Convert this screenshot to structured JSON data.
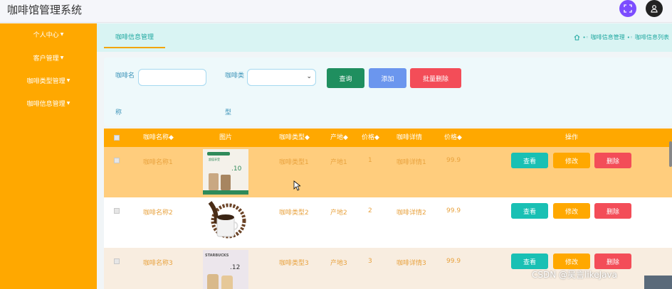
{
  "header": {
    "title": "咖啡馆管理系统",
    "expand_icon": "fullscreen-icon",
    "user_icon": "user-icon"
  },
  "sidebar": {
    "items": [
      {
        "label": "个人中心"
      },
      {
        "label": "客户管理"
      },
      {
        "label": "咖啡类型管理"
      },
      {
        "label": "咖啡信息管理"
      }
    ]
  },
  "tabs": {
    "active": "咖啡信息管理"
  },
  "breadcrumb": {
    "home_icon": "home-icon",
    "items": [
      "咖啡信息管理",
      "咖啡信息列表"
    ]
  },
  "search": {
    "name_label_1": "咖啡名",
    "name_label_2": "称",
    "name_value": "",
    "type_label_1": "咖啡类",
    "type_label_2": "型",
    "type_value": "",
    "query_label": "查询",
    "add_label": "添加",
    "batch_delete_label": "批量删除"
  },
  "table": {
    "headers": [
      "咖啡名称◆",
      "图片",
      "咖啡类型◆",
      "产地◆",
      "价格◆",
      "咖啡详情",
      "价格◆",
      "操作"
    ],
    "rows": [
      {
        "name": "咖啡名称1",
        "type": "咖啡类型1",
        "origin": "产地1",
        "price1": "1",
        "detail": "咖啡详情1",
        "price2": "99.9",
        "img_text1": "超值享受",
        "img_text2": ".10"
      },
      {
        "name": "咖啡名称2",
        "type": "咖啡类型2",
        "origin": "产地2",
        "price1": "2",
        "detail": "咖啡详情2",
        "price2": "99.9"
      },
      {
        "name": "咖啡名称3",
        "type": "咖啡类型3",
        "origin": "产地3",
        "price1": "3",
        "detail": "咖啡详情3",
        "price2": "99.9",
        "img_text1": "STARBUCKS",
        "img_text2": ".12"
      }
    ],
    "action_view": "查看",
    "action_edit": "修改",
    "action_delete": "删除"
  },
  "watermark": "CSDN @吴言likeJava",
  "colors": {
    "sidebar": "#ffa800",
    "header_row": "#ffa800",
    "view": "#19c0b4",
    "edit": "#ffa800",
    "delete": "#f34d58",
    "query": "#1f8f5f",
    "add": "#6b96ee"
  }
}
